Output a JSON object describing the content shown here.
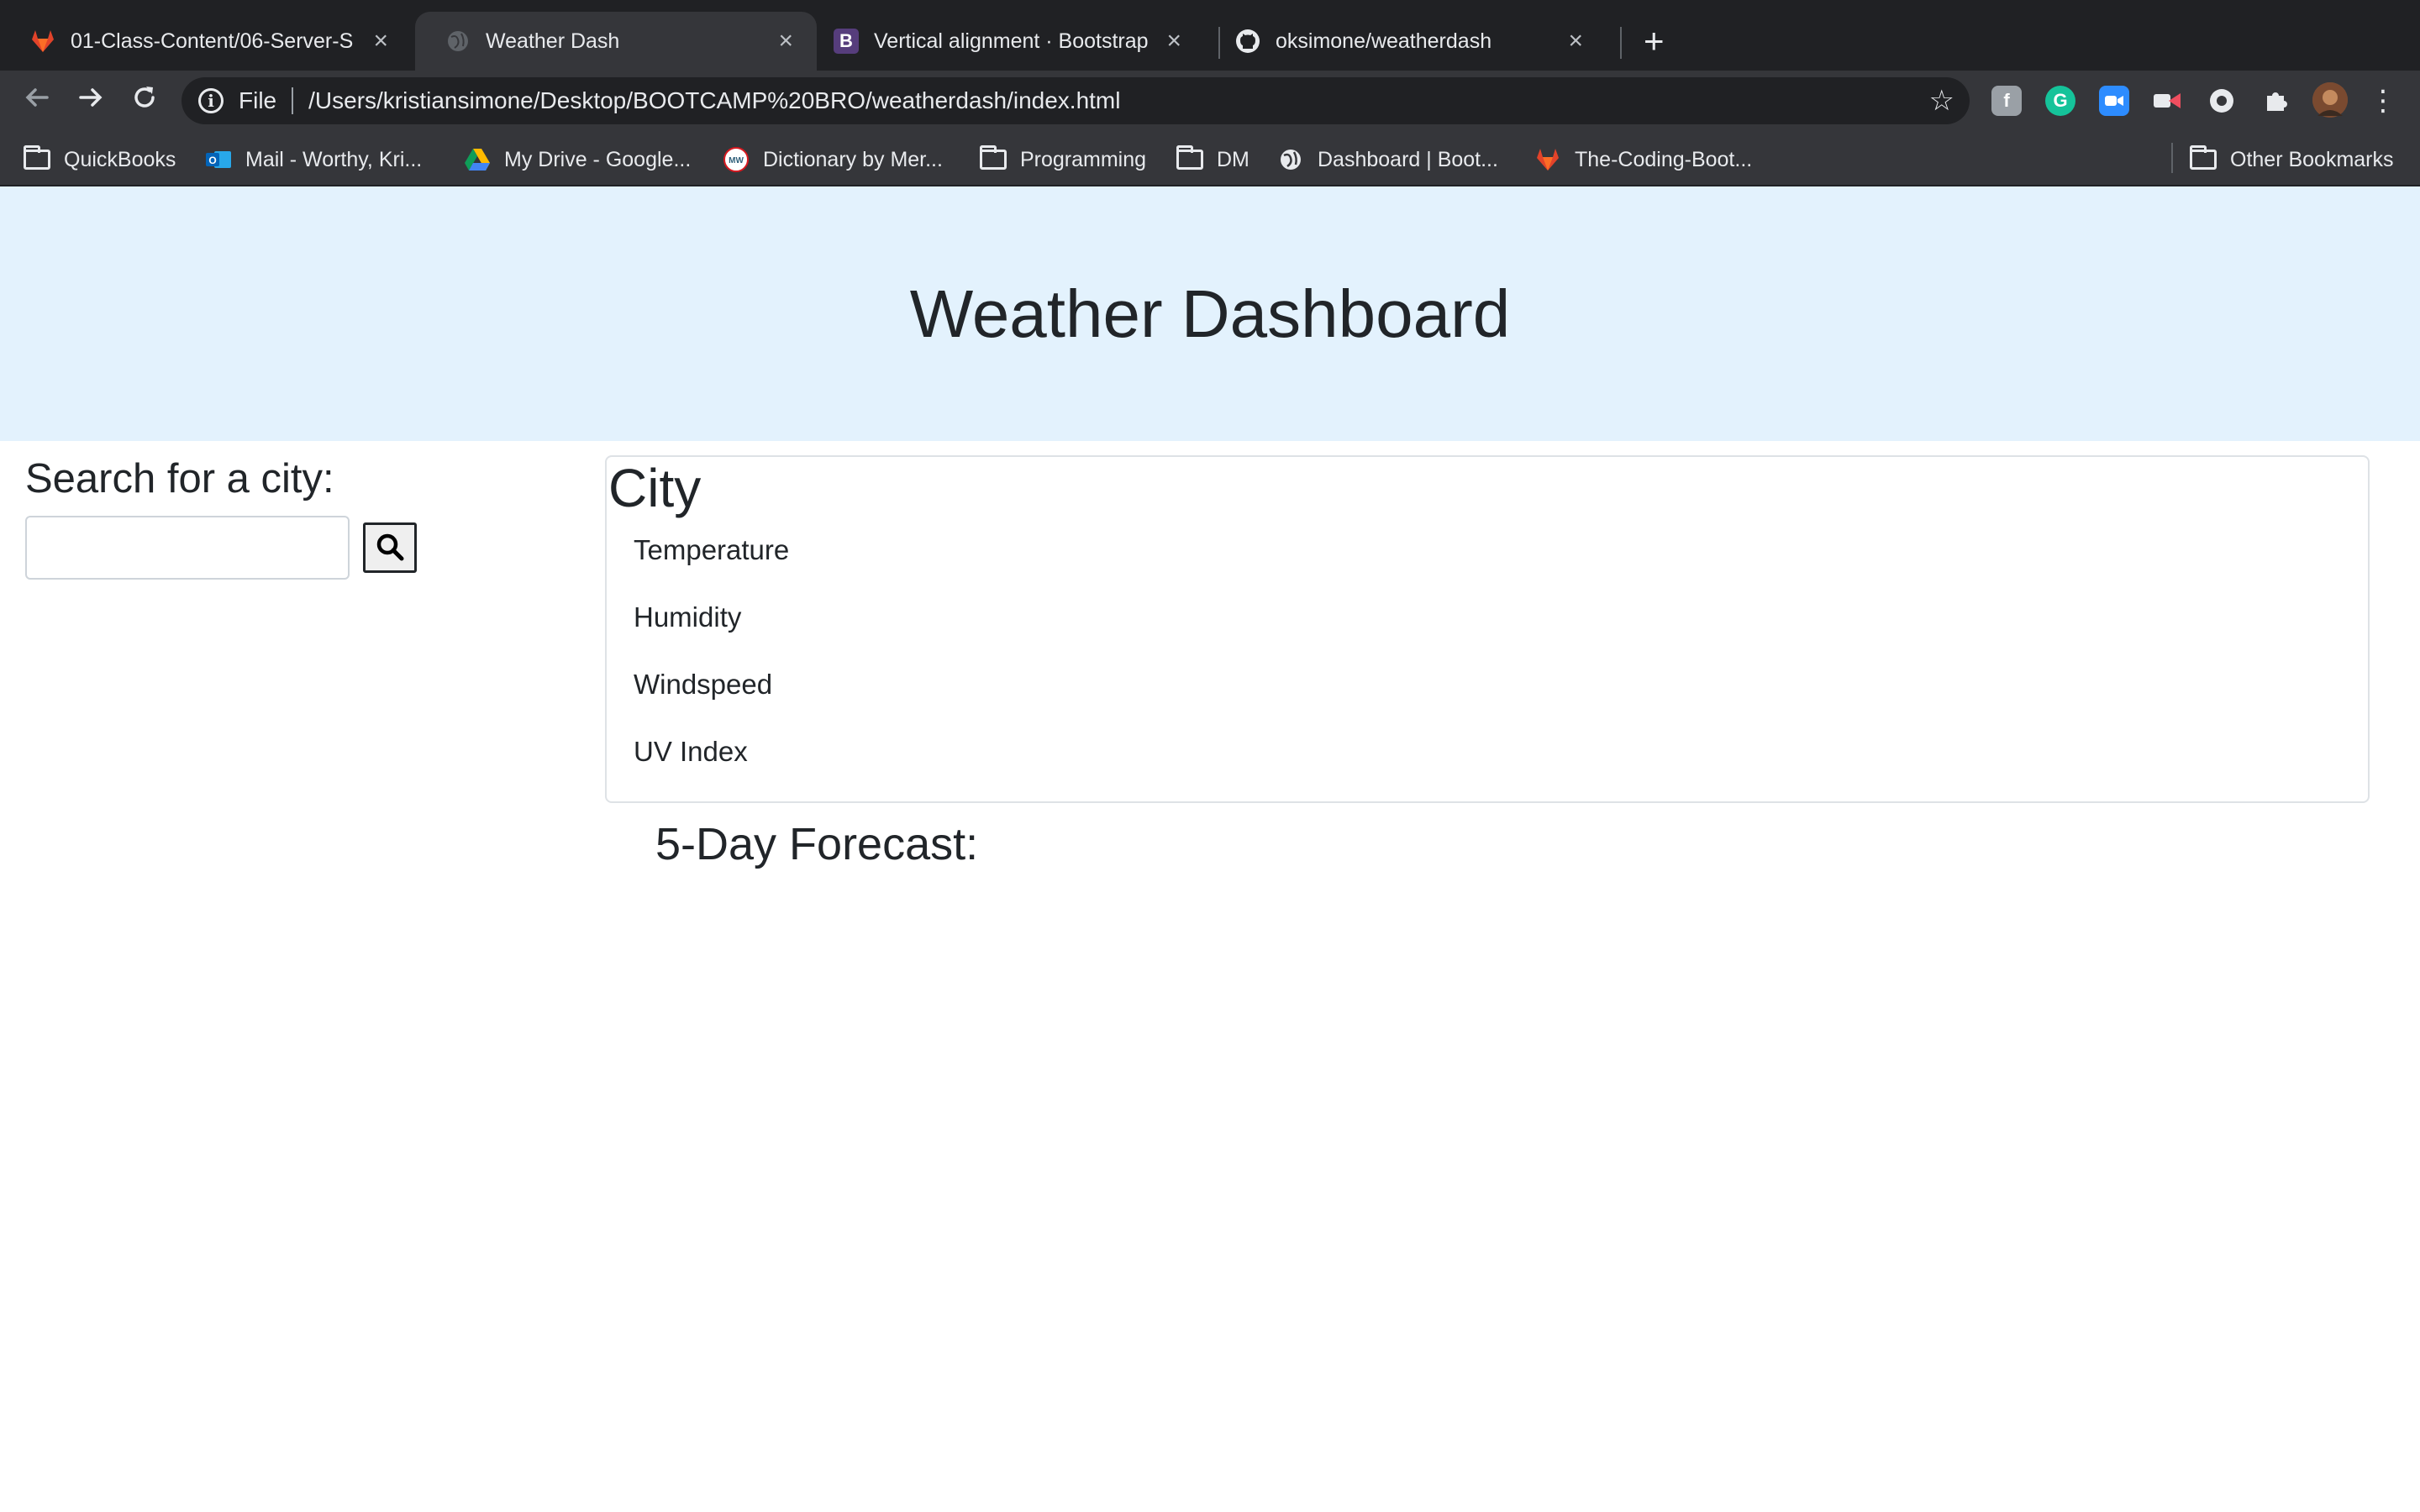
{
  "browser": {
    "tabs": [
      {
        "title": "01-Class-Content/06-Server-S",
        "icon": "gitlab-icon"
      },
      {
        "title": "Weather Dash",
        "icon": "globe-icon"
      },
      {
        "title": "Vertical alignment · Bootstrap",
        "icon": "bootstrap-icon"
      },
      {
        "title": "oksimone/weatherdash",
        "icon": "github-icon"
      }
    ],
    "address": {
      "scheme": "File",
      "url": "/Users/kristiansimone/Desktop/BOOTCAMP%20BRO/weatherdash/index.html"
    },
    "bookmarks": [
      {
        "label": "QuickBooks",
        "icon": "folder-icon"
      },
      {
        "label": "Mail - Worthy, Kri...",
        "icon": "outlook-icon"
      },
      {
        "label": "My Drive - Google...",
        "icon": "google-drive-icon"
      },
      {
        "label": "Dictionary by Mer...",
        "icon": "merriam-webster-icon"
      },
      {
        "label": "Programming",
        "icon": "folder-icon"
      },
      {
        "label": "DM",
        "icon": "folder-icon"
      },
      {
        "label": "Dashboard | Boot...",
        "icon": "globe-icon"
      },
      {
        "label": "The-Coding-Boot...",
        "icon": "gitlab-icon"
      },
      {
        "label": "Other Bookmarks",
        "icon": "folder-icon"
      }
    ]
  },
  "page": {
    "title": "Weather Dashboard",
    "search": {
      "label": "Search for a city:",
      "placeholder": "",
      "value": ""
    },
    "current": {
      "city": "City",
      "fields": [
        "Temperature",
        "Humidity",
        "Windspeed",
        "UV Index"
      ]
    },
    "forecast_heading": "5-Day Forecast:"
  },
  "colors": {
    "header_bg": "#e3f2fd",
    "text": "#212529",
    "chrome_dark": "#202124",
    "chrome_toolbar": "#35363a"
  }
}
